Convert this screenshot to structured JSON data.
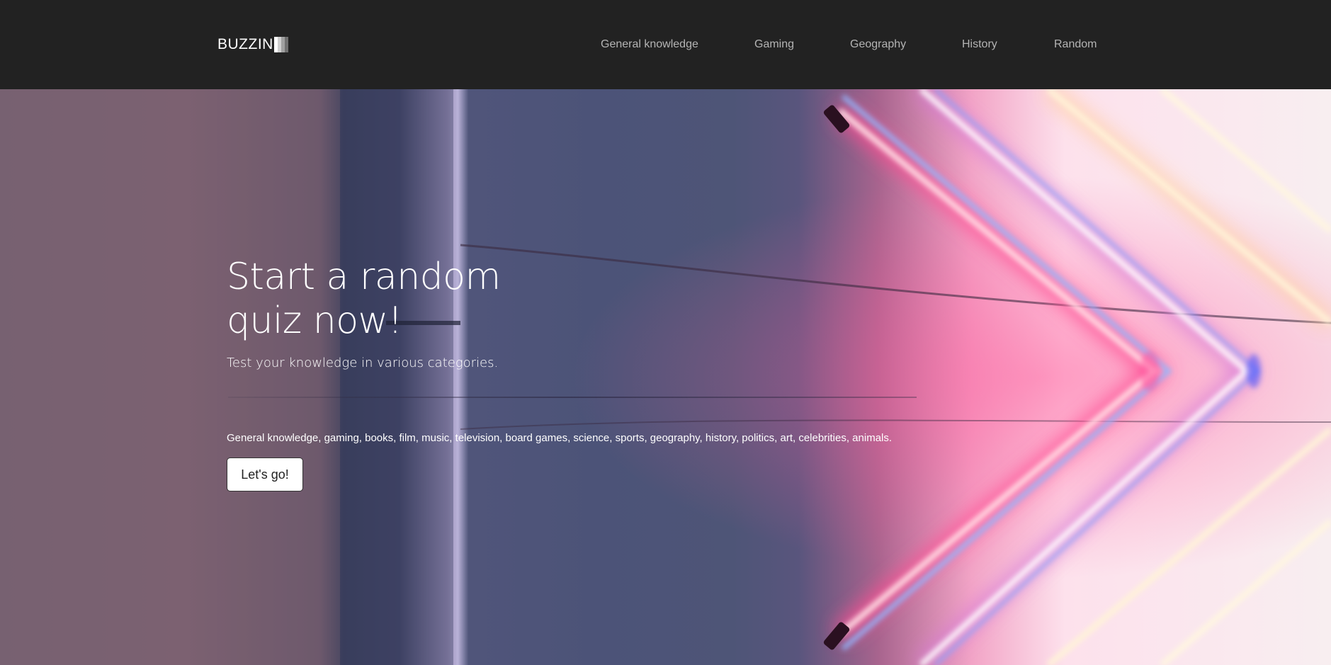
{
  "navbar": {
    "brand": "BUZZIN",
    "links": [
      {
        "label": "General knowledge"
      },
      {
        "label": "Gaming"
      },
      {
        "label": "Geography"
      },
      {
        "label": "History"
      },
      {
        "label": "Random"
      }
    ]
  },
  "hero": {
    "title_line1": "Start a random",
    "title_line2": "quiz now!",
    "subtitle": "Test your knowledge in various categories.",
    "categories": "General knowledge, gaming, books, film, music, television, board games, science, sports, geography, history, politics, art, celebrities, animals.",
    "cta_label": "Let's go!"
  },
  "colors": {
    "navbar_bg": "#222222",
    "nav_link": "#b4b4b4",
    "hero_text": "#ffffff",
    "button_bg": "#ffffff"
  },
  "icons": {
    "brand_mark": "gradient-bars-icon"
  }
}
